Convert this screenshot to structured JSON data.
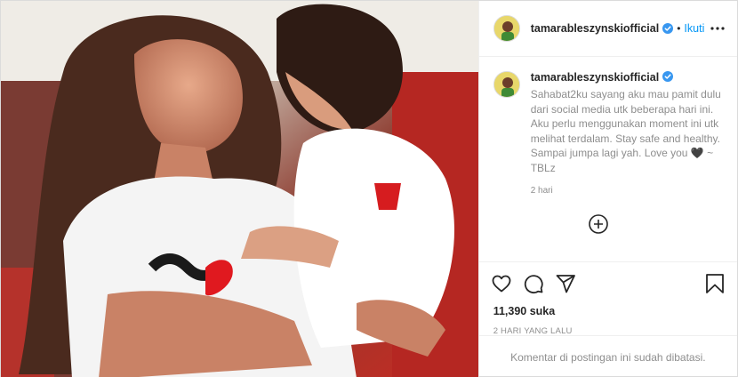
{
  "post": {
    "username": "tamarableszynskiofficial",
    "verified": true,
    "follow_label": "Ikuti",
    "separator": "•",
    "more_icon": "more-horizontal-icon",
    "caption": {
      "username": "tamarableszynskiofficial",
      "text": "Sahabat2ku sayang aku mau pamit dulu dari social media utk beberapa hari ini. Aku perlu menggunakan moment ini utk melihat terdalam. Stay safe and healthy. Sampai jumpa lagi yah. Love you 🖤 ~ TBLz",
      "time": "2 hari"
    },
    "load_more_icon": "plus-circle-icon",
    "actions": {
      "like_icon": "heart-icon",
      "comment_icon": "comment-icon",
      "share_icon": "paper-plane-icon",
      "save_icon": "bookmark-icon"
    },
    "likes": "11,390 suka",
    "time_ago": "2 HARI YANG LALU",
    "comments_disabled": "Komentar di postingan ini sudah dibatasi.",
    "colors": {
      "link_blue": "#0095f6",
      "verified_blue": "#3897f0",
      "muted": "#8e8e8e",
      "border": "#dbdbdb"
    }
  }
}
